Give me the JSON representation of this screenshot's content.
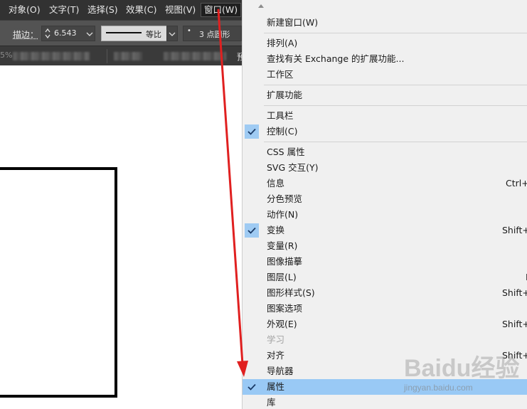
{
  "menubar": {
    "items": [
      "对象(O)",
      "文字(T)",
      "选择(S)",
      "效果(C)",
      "视图(V)",
      "窗口(W)"
    ],
    "active": "窗口(W)"
  },
  "controlbar": {
    "stroke_label": "描边：",
    "stroke_value": "6.543",
    "profile_label": "等比",
    "brush_label": "3 点圆形"
  },
  "tabbar": {
    "partial_text_left": "5%",
    "partial_text_right": "预"
  },
  "window_menu": {
    "items": [
      {
        "label": "新建窗口(W)"
      },
      {
        "separator": true
      },
      {
        "label": "排列(A)"
      },
      {
        "label": "查找有关 Exchange 的扩展功能..."
      },
      {
        "label": "工作区"
      },
      {
        "separator": true
      },
      {
        "label": "扩展功能"
      },
      {
        "separator": true
      },
      {
        "label": "工具栏"
      },
      {
        "label": "控制(C)",
        "checked": true
      },
      {
        "separator": true
      },
      {
        "label": "CSS 属性"
      },
      {
        "label": "SVG 交互(Y)"
      },
      {
        "label": "信息",
        "shortcut": "Ctrl+I"
      },
      {
        "label": "分色预览"
      },
      {
        "label": "动作(N)"
      },
      {
        "label": "变换",
        "shortcut": "Shift+I",
        "checked": true
      },
      {
        "label": "变量(R)"
      },
      {
        "label": "图像描摹"
      },
      {
        "label": "图层(L)",
        "shortcut": "I"
      },
      {
        "label": "图形样式(S)",
        "shortcut": "Shift+I"
      },
      {
        "label": "图案选项"
      },
      {
        "label": "外观(E)",
        "shortcut": "Shift+I"
      },
      {
        "label": "学习",
        "disabled": true
      },
      {
        "label": "对齐",
        "shortcut": "Shift+I"
      },
      {
        "label": "导航器"
      },
      {
        "label": "属性",
        "checked": true,
        "selected": true
      },
      {
        "label": "库"
      }
    ]
  },
  "watermark": {
    "main": "Baidu经验",
    "sub": "jingyan.baidu.com"
  },
  "colors": {
    "menubar_bg": "#323232",
    "controlbar_bg": "#535353",
    "menu_bg": "#f0f0f0",
    "highlight": "#99c9f5",
    "check_bg": "#9fcbf3",
    "arrow": "#e02020"
  },
  "icons": [
    "checkmark-icon",
    "scroll-up-arrow-icon",
    "chevron-down-icon",
    "spinner-icon"
  ]
}
